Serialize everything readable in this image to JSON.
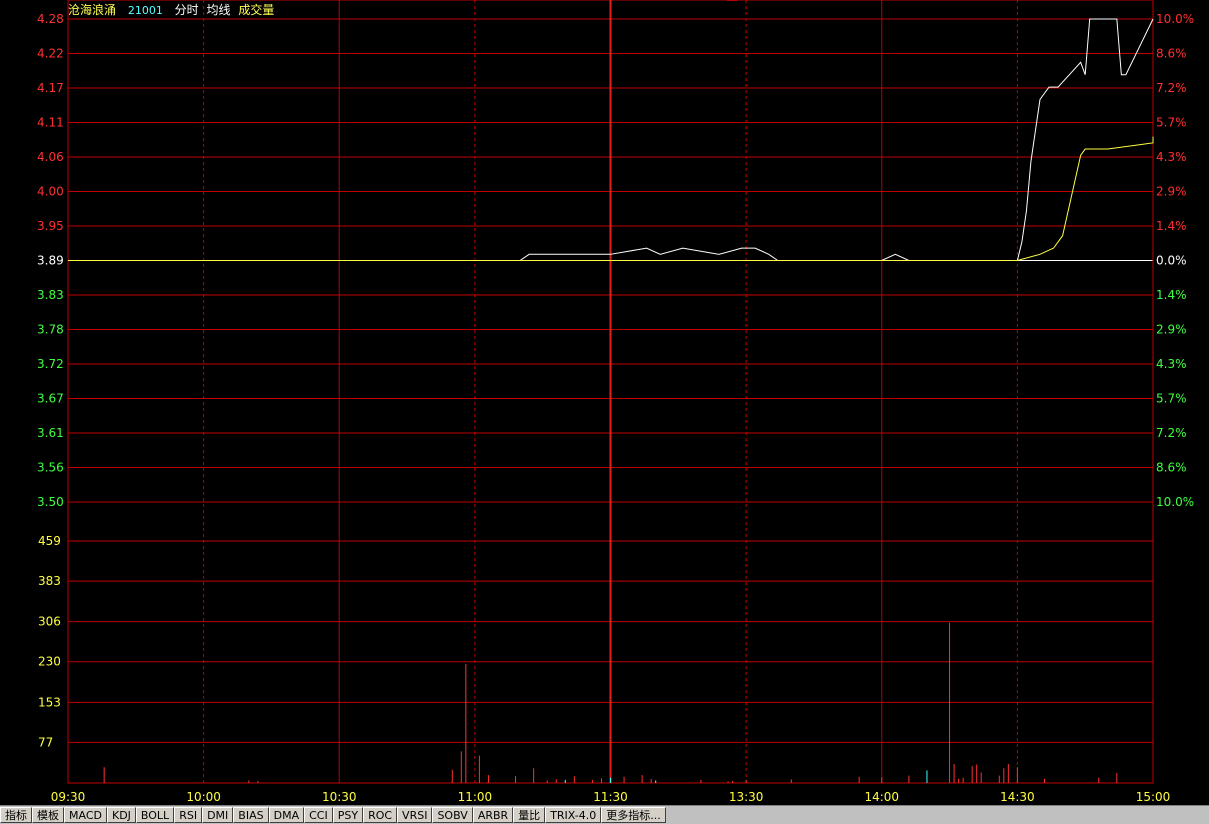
{
  "header": {
    "stock_name": "沧海浪涌",
    "stock_code": "21001",
    "mode": "分时",
    "avg_line_label": "均线",
    "volume_label": "成交量"
  },
  "tabs": [
    "指标",
    "模板",
    "MACD",
    "KDJ",
    "BOLL",
    "RSI",
    "DMI",
    "BIAS",
    "DMA",
    "CCI",
    "PSY",
    "ROC",
    "VRSI",
    "SOBV",
    "ARBR",
    "量比",
    "TRIX-4.0",
    "更多指标..."
  ],
  "colors": {
    "background": "#000000",
    "grid": "#c00000",
    "up": "#ff3030",
    "down": "#40ff40",
    "neutral": "#ffffff",
    "axis_time": "#ffff40",
    "price_line": "#ffffff",
    "avg_line": "#ffff40",
    "vol_up": "#ff3030",
    "vol_down": "#40ffff"
  },
  "chart_data": {
    "type": "line",
    "prev_close": 3.89,
    "price_ticks": [
      "4.28",
      "4.22",
      "4.17",
      "4.11",
      "4.06",
      "4.00",
      "3.95",
      "3.89",
      "3.83",
      "3.78",
      "3.72",
      "3.67",
      "3.61",
      "3.56",
      "3.50"
    ],
    "pct_ticks": [
      "10.0%",
      "8.6%",
      "7.2%",
      "5.7%",
      "4.3%",
      "2.9%",
      "1.4%",
      "0.0%",
      "1.4%",
      "2.9%",
      "4.3%",
      "5.7%",
      "7.2%",
      "8.6%",
      "10.0%"
    ],
    "ylim": [
      3.5,
      4.28
    ],
    "volume_ticks": [
      "459",
      "383",
      "306",
      "230",
      "153",
      "77"
    ],
    "volume_max": 536,
    "x_ticks": [
      "09:30",
      "10:00",
      "10:30",
      "11:00",
      "11:30",
      "13:30",
      "14:00",
      "14:30",
      "15:00"
    ],
    "total_minutes": 240,
    "series": [
      {
        "key": "price",
        "x": [
          0,
          90,
          100,
          102,
          105,
          120,
          128,
          131,
          136,
          144,
          149,
          152,
          155,
          157,
          160,
          180,
          183,
          186,
          192,
          200,
          210,
          211,
          212,
          213,
          215,
          217,
          219,
          224,
          225,
          226,
          228,
          232,
          233,
          234,
          240
        ],
        "y": [
          3.89,
          3.89,
          3.89,
          3.9,
          3.9,
          3.9,
          3.91,
          3.9,
          3.91,
          3.9,
          3.91,
          3.91,
          3.9,
          3.89,
          3.89,
          3.89,
          3.9,
          3.89,
          3.89,
          3.89,
          3.89,
          3.92,
          3.97,
          4.05,
          4.15,
          4.17,
          4.17,
          4.21,
          4.19,
          4.28,
          4.28,
          4.28,
          4.19,
          4.19,
          4.28
        ]
      },
      {
        "key": "average",
        "x": [
          0,
          90,
          100,
          120,
          150,
          180,
          200,
          210,
          215,
          218,
          220,
          224,
          225,
          226,
          230,
          240,
          252,
          260,
          268,
          270
        ],
        "y": [
          3.89,
          3.89,
          3.89,
          3.89,
          3.89,
          3.89,
          3.89,
          3.89,
          3.9,
          3.91,
          3.93,
          4.06,
          4.07,
          4.07,
          4.07,
          4.08,
          4.08,
          4.09,
          4.09,
          4.09
        ]
      }
    ],
    "volume": {
      "x": [
        8,
        40,
        42,
        85,
        87,
        88,
        91,
        93,
        99,
        103,
        106,
        108,
        110,
        112,
        116,
        118,
        120,
        123,
        127,
        129,
        130,
        140,
        146,
        147,
        150,
        160,
        175,
        180,
        186,
        190,
        196,
        197,
        198,
        200,
        201,
        202,
        206,
        207,
        208,
        210,
        216,
        228,
        232
      ],
      "v": [
        30,
        5,
        4,
        25,
        60,
        226,
        52,
        15,
        13,
        28,
        5,
        7,
        6,
        13,
        6,
        9,
        10,
        12,
        15,
        8,
        5,
        6,
        3,
        4,
        6,
        7,
        12,
        11,
        14,
        24,
        36,
        8,
        10,
        32,
        35,
        20,
        14,
        28,
        36,
        30,
        8,
        10,
        19
      ],
      "dir": [
        "u",
        "u",
        "u",
        "u",
        "u",
        "u",
        "u",
        "u",
        "u",
        "u",
        "u",
        "u",
        "d",
        "u",
        "u",
        "u",
        "d",
        "u",
        "u",
        "u",
        "d",
        "u",
        "u",
        "u",
        "u",
        "u",
        "u",
        "u",
        "u",
        "d",
        "u",
        "u",
        "u",
        "u",
        "u",
        "u",
        "u",
        "u",
        "u",
        "u",
        "u",
        "u",
        "u"
      ]
    },
    "big_volume": {
      "x": 195,
      "v": 304
    }
  }
}
